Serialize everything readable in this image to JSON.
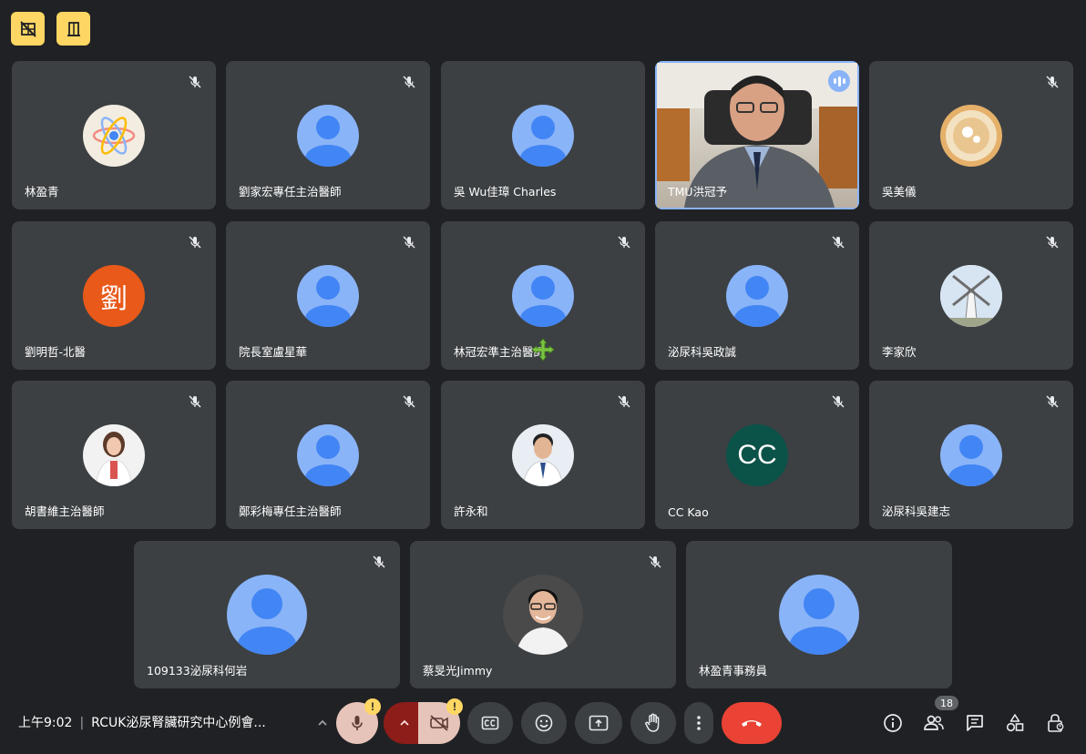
{
  "participants_row1": [
    {
      "name": "林盈青"
    },
    {
      "name": "劉家宏專任主治醫師"
    },
    {
      "name": "吳 Wu佳璋 Charles"
    },
    {
      "name": "TMU洪冠予"
    },
    {
      "name": "吳美儀"
    }
  ],
  "participants_row2": [
    {
      "name": "劉明哲-北醫",
      "initial": "劉"
    },
    {
      "name": "院長室盧星華"
    },
    {
      "name": "林冠宏準主治醫師"
    },
    {
      "name": "泌尿科吳政誠"
    },
    {
      "name": "李家欣"
    }
  ],
  "participants_row3": [
    {
      "name": "胡書維主治醫師"
    },
    {
      "name": "鄭彩梅專任主治醫師"
    },
    {
      "name": "許永和"
    },
    {
      "name": "CC Kao",
      "initial": "CC"
    },
    {
      "name": "泌尿科吳建志"
    }
  ],
  "participants_row4": [
    {
      "name": "109133泌尿科何岩"
    },
    {
      "name": "蔡旻光Jimmy"
    },
    {
      "name": "林盈青事務員"
    }
  ],
  "bottom_bar": {
    "time": "上午9:02",
    "separator": "|",
    "meeting_title": "RCUK泌尿腎臟研究中心例會...",
    "people_count": "18",
    "warn_mark": "!"
  },
  "colors": {
    "background": "#202124",
    "tile": "#3c4043",
    "accent_blue": "#8ab4f8",
    "warning": "#fdd663",
    "end_call": "#ea4335",
    "letter_avatar_orange": "#e8591a",
    "letter_avatar_teal": "#0b5248"
  }
}
